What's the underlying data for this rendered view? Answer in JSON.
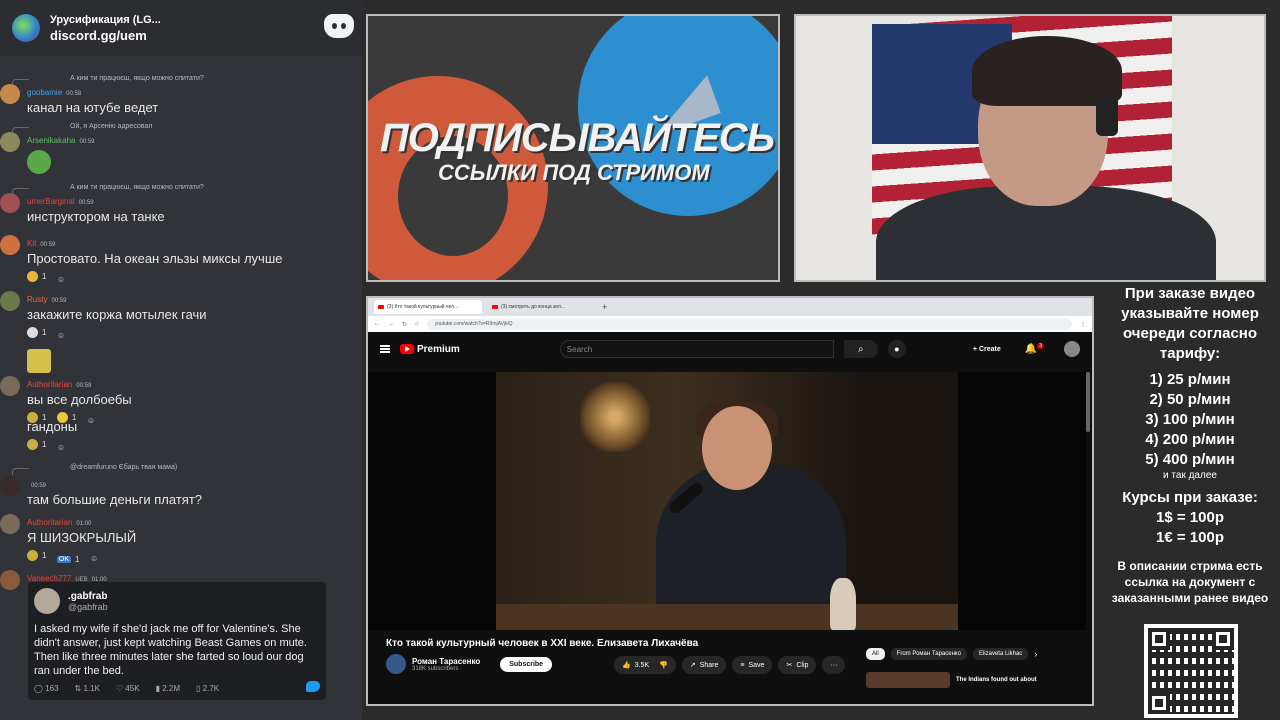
{
  "chat": {
    "server_title": "Урусификация (LG...",
    "invite": "discord.gg/uem",
    "messages": [
      {
        "reply": "А ким ти працюєш, якщо можно спитати?",
        "user": "goobamie",
        "user_color": "#4aa0e8",
        "time": "00:58",
        "text": "канал на ютубе ведет"
      },
      {
        "reply": "Ой, я Арсенію адресовал",
        "user": "Arsenikakaha",
        "user_color": "#5fbf6a",
        "time": "00:59",
        "text": ""
      },
      {
        "reply": "А ким ти працюєш, якщо можно спитати?",
        "user": "umerBarginal",
        "user_color": "#e8453c",
        "time": "00:59",
        "text": "инструктором на танке"
      },
      {
        "user": "Kit",
        "user_color": "#e8453c",
        "time": "00:59",
        "text": "Простовато. На океан эльзы миксы лучше",
        "reactions": [
          {
            "count": "1"
          }
        ]
      },
      {
        "user": "Rusty",
        "user_color": "#e86a3c",
        "time": "00:59",
        "text": "закажите коржа мотылек гачи",
        "reactions": [
          {
            "count": "1"
          }
        ]
      },
      {
        "user": "Authoritarian",
        "user_color": "#e84a3c",
        "time": "00:59",
        "text": "вы все долбоебы",
        "reactions": [
          {
            "count": "1"
          },
          {
            "count": "1"
          }
        ]
      },
      {
        "text": "гандоны",
        "reactions": [
          {
            "count": "1"
          }
        ]
      },
      {
        "reply": "@dreamfuruno Єбарь твая мама)",
        "user": "",
        "user_color": "#5fbf6a",
        "time": "00:59",
        "text": "там большие деньги платят?"
      },
      {
        "user": "Authoritarian",
        "user_color": "#e84a3c",
        "time": "01:00",
        "text": "Я ШИЗОКРЫЛЫЙ",
        "reactions": [
          {
            "count": "1"
          },
          {
            "label": "OK",
            "count": "1"
          }
        ]
      },
      {
        "user": "Vaneech777",
        "user_color": "#e8453c",
        "tag": "UEB",
        "time": "01:00",
        "text": ""
      }
    ],
    "tweet": {
      "name": ".gabfrab",
      "handle": "@gabfrab",
      "text": "I asked my wife if she'd jack me off for Valentine's. She didn't answer, just kept watching Beast Games on mute. Then like three minutes later she farted so loud our dog ran under the bed.",
      "replies": "163",
      "retweets": "1.1K",
      "likes": "45K",
      "views": "2.2M",
      "bookmarks": "2.7K"
    }
  },
  "promo": {
    "title": "ПОДПИСЫВАЙТЕСЬ",
    "subtitle": "ССЫЛКИ ПОД СТРИМОМ",
    "red_color": "#cf5a3b",
    "blue_color": "#2d8fd0"
  },
  "browser": {
    "tabs": [
      {
        "label": "(3) Кто такой культурный чел..."
      },
      {
        "label": "(3) смотреть до конца зел..."
      }
    ],
    "url": "youtube.com/watch?v=R9mjAVjklQ",
    "youtube": {
      "logo": "Premium",
      "search_placeholder": "Search",
      "create_label": "Create",
      "notifications": "3",
      "video_title": "Кто такой культурный человек в XXI веке. Елизавета Лихачёва",
      "channel_name": "Роман Тарасенко",
      "subscribers": "318K subscribers",
      "subscribe_label": "Subscribe",
      "likes": "3.5K",
      "share_label": "Share",
      "save_label": "Save",
      "clip_label": "Clip",
      "chips": [
        "All",
        "From Роман Тарасенко",
        "Elizaveta Likhac"
      ],
      "rec_title": "The Indians found out about"
    }
  },
  "info": {
    "order_text": "При заказе видео указывайте номер очереди согласно тарифу:",
    "tariffs": [
      "1) 25 р/мин",
      "2) 50 р/мин",
      "3) 100 р/мин",
      "4) 200 р/мин",
      "5) 400 р/мин"
    ],
    "etc": "и так далее",
    "courses_title": "Курсы при заказе:",
    "rates": [
      "1$ = 100р",
      "1€ = 100р"
    ],
    "doc_text": "В описании стрима есть ссылка на документ с заказанными ранее видео"
  }
}
